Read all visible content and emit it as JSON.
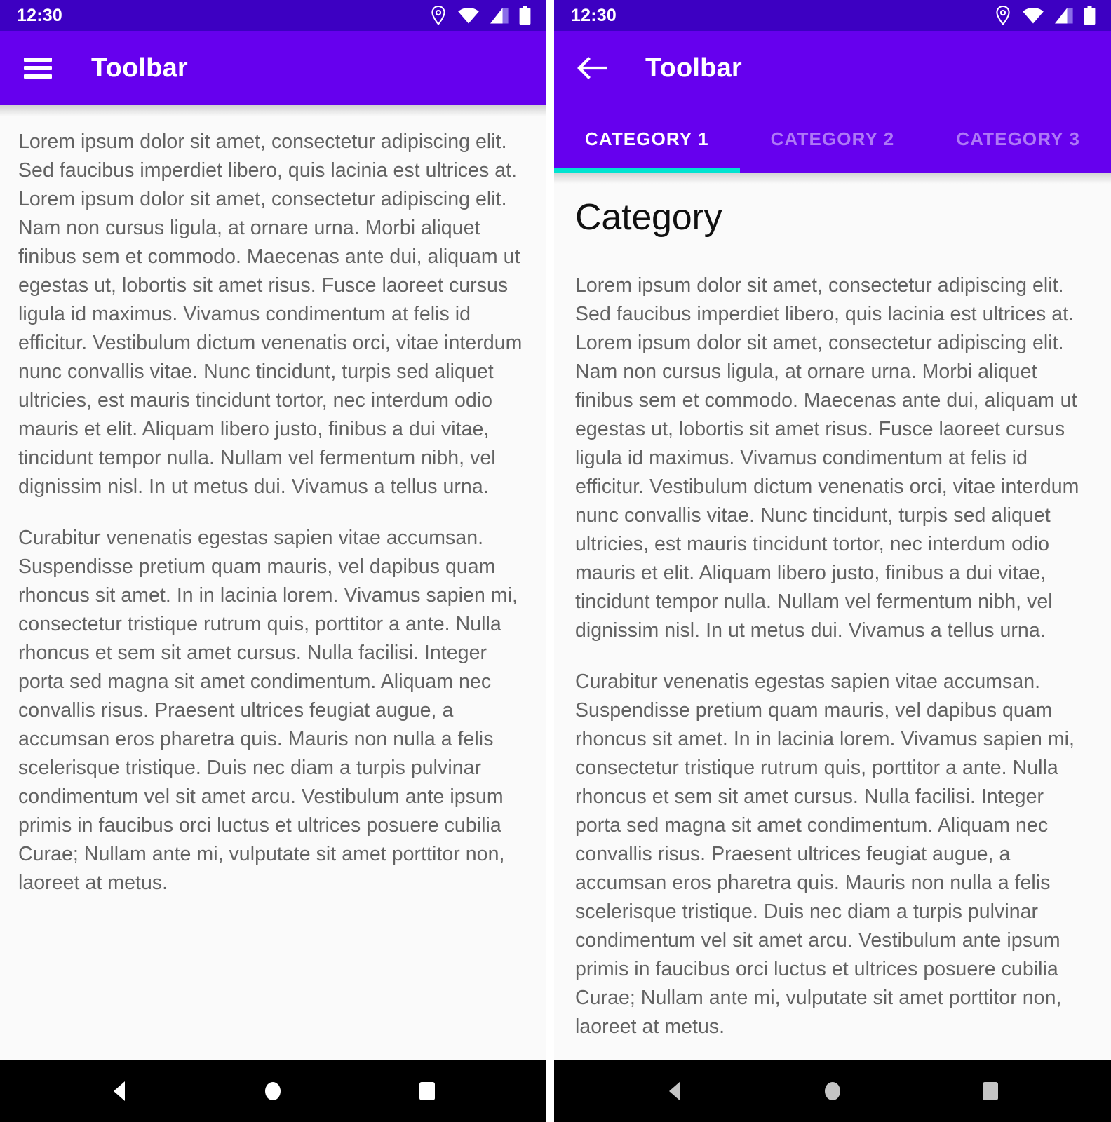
{
  "colors": {
    "status_bar": "#3d00c2",
    "toolbar": "#6600ee",
    "tab_indicator": "#00e3d0",
    "content_bg": "#fafafa",
    "body_text": "#636363",
    "heading_text": "#111111",
    "nav_bar": "#000000",
    "nav_icon_left": "#ffffff",
    "nav_icon_right": "#c4c4c4"
  },
  "body_paragraphs": {
    "p1": "Lorem ipsum dolor sit amet, consectetur adipiscing elit. Sed faucibus imperdiet libero, quis lacinia est ultrices at. Lorem ipsum dolor sit amet, consectetur adipiscing elit. Nam non cursus ligula, at ornare urna. Morbi aliquet finibus sem et commodo. Maecenas ante dui, aliquam ut egestas ut, lobortis sit amet risus. Fusce laoreet cursus ligula id maximus. Vivamus condimentum at felis id efficitur. Vestibulum dictum venenatis orci, vitae interdum nunc convallis vitae. Nunc tincidunt, turpis sed aliquet ultricies, est mauris tincidunt tortor, nec interdum odio mauris et elit. Aliquam libero justo, finibus a dui vitae, tincidunt tempor nulla. Nullam vel fermentum nibh, vel dignissim nisl. In ut metus dui. Vivamus a tellus urna.",
    "p2": "Curabitur venenatis egestas sapien vitae accumsan. Suspendisse pretium quam mauris, vel dapibus quam rhoncus sit amet. In in lacinia lorem. Vivamus sapien mi, consectetur tristique rutrum quis, porttitor a ante. Nulla rhoncus et sem sit amet cursus. Nulla facilisi. Integer porta sed magna sit amet condimentum. Aliquam nec convallis risus. Praesent ultrices feugiat augue, a accumsan eros pharetra quis. Mauris non nulla a felis scelerisque tristique. Duis nec diam a turpis pulvinar condimentum vel sit amet arcu. Vestibulum ante ipsum primis in faucibus orci luctus et ultrices posuere cubilia Curae; Nullam ante mi, vulputate sit amet porttitor non, laoreet at metus."
  },
  "left_screen": {
    "status": {
      "time": "12:30",
      "icons": [
        "location-pin-icon",
        "wifi-icon",
        "cellular-signal-icon",
        "battery-icon"
      ]
    },
    "toolbar": {
      "nav_icon": "hamburger-menu-icon",
      "title": "Toolbar"
    },
    "navigation_bar": {
      "back": "triangle-back-icon",
      "home": "circle-home-icon",
      "recents": "square-recents-icon"
    }
  },
  "right_screen": {
    "status": {
      "time": "12:30",
      "icons": [
        "location-pin-icon",
        "wifi-icon",
        "cellular-signal-icon",
        "battery-icon"
      ]
    },
    "toolbar": {
      "nav_icon": "arrow-back-icon",
      "title": "Toolbar"
    },
    "tabs": [
      {
        "label": "CATEGORY 1",
        "active": true
      },
      {
        "label": "CATEGORY 2",
        "active": false
      },
      {
        "label": "CATEGORY 3",
        "active": false
      }
    ],
    "heading": "Category",
    "navigation_bar": {
      "back": "triangle-back-icon",
      "home": "circle-home-icon",
      "recents": "square-recents-icon"
    }
  }
}
